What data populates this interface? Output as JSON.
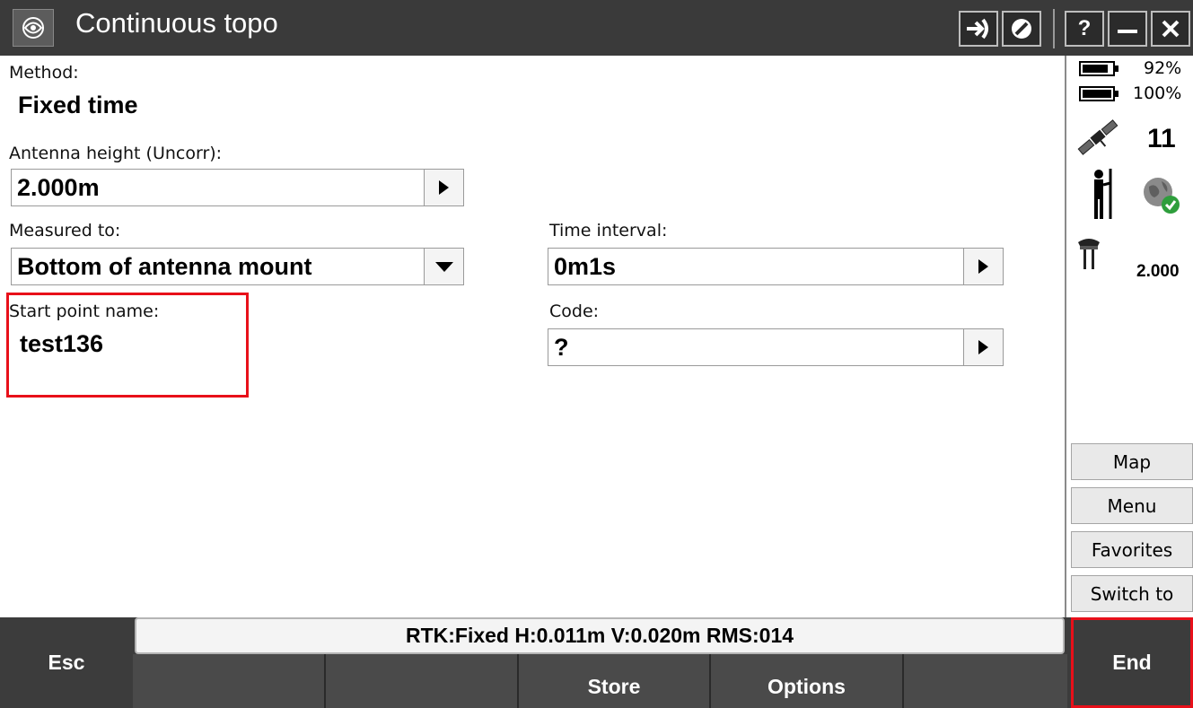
{
  "window": {
    "title": "Continuous topo"
  },
  "form": {
    "method_label": "Method:",
    "method_value": "Fixed time",
    "antenna_height_label": "Antenna height (Uncorr):",
    "antenna_height_value": "2.000m",
    "measured_to_label": "Measured to:",
    "measured_to_value": "Bottom of antenna mount",
    "time_interval_label": "Time interval:",
    "time_interval_value": "0m1s",
    "start_point_label": "Start point name:",
    "start_point_value": "test136",
    "code_label": "Code:",
    "code_value": "?"
  },
  "status_panel": {
    "battery1": "92%",
    "battery2": "100%",
    "satellites": "11",
    "antenna_height": "2.000"
  },
  "side_buttons": {
    "map": "Map",
    "menu": "Menu",
    "favorites": "Favorites",
    "switch_to": "Switch to"
  },
  "status_bar": "RTK:Fixed H:0.011m V:0.020m RMS:014",
  "softkeys": {
    "esc": "Esc",
    "store": "Store",
    "options": "Options",
    "end": "End"
  },
  "colors": {
    "titlebar": "#3a3a3a",
    "highlight": "#e8101a",
    "softkey_bar": "#4a4a4a"
  },
  "icons": [
    "app-logo-icon",
    "login-arrow-icon",
    "no-entry-icon",
    "help-icon",
    "minimize-icon",
    "close-icon",
    "battery-icon",
    "satellite-icon",
    "surveyor-pole-icon",
    "globe-check-icon",
    "antenna-icon"
  ]
}
